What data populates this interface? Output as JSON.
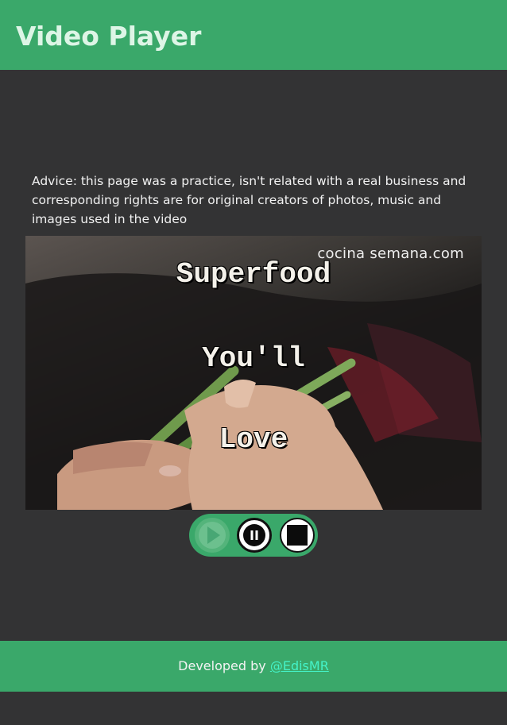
{
  "header": {
    "title": "Video Player"
  },
  "advice": {
    "text": "Advice: this page was a practice, isn't related with a real business and corresponding rights are for original creators of photos, music and images used in the video"
  },
  "video": {
    "watermark": "cocina semana.com",
    "lines": [
      "Superfood",
      "You'll",
      "Love"
    ]
  },
  "controls": {
    "play_icon": "play-icon",
    "pause_icon": "pause-icon",
    "stop_icon": "stop-icon"
  },
  "footer": {
    "credit_prefix": "Developed by",
    "credit_link": "@EdisMR"
  },
  "colors": {
    "accent": "#3aa86a",
    "background": "#333334",
    "link": "#44f3c8"
  }
}
